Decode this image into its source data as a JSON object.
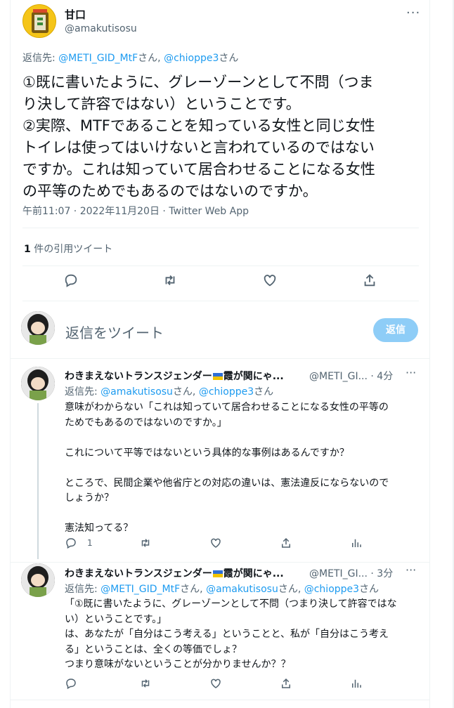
{
  "main_tweet": {
    "author_name": "甘口",
    "author_handle": "@amakutisosu",
    "reply_prefix": "返信先: ",
    "reply_to": [
      "@METI_GID_MtF",
      "さん, ",
      "@chioppe3",
      "さん"
    ],
    "text": "①既に書いたように、グレーゾーンとして不問（つま\nり決して許容ではない）ということです。\n②実際、MTFであることを知っている女性と同じ女性\nトイレは使ってはいけないと言われているのではない\nですか。これは知っていて居合わせることになる女性\nの平等のためでもあるのではないのですか。",
    "meta": "午前11:07 · 2022年11月20日 · Twitter Web App",
    "quote_count": "1",
    "quote_label": " 件の引用ツイート"
  },
  "composer": {
    "placeholder": "返信をツイート",
    "reply_button": "返信"
  },
  "replies": [
    {
      "name_pre": "わきまえないトランスジェンダー",
      "name_post": "霞が関にゃ...",
      "handle": "@METI_GI...",
      "time": " · 4分",
      "reply_prefix": "返信先: ",
      "reply_to": [
        "@amakutisosu",
        "さん, ",
        "@chioppe3",
        "さん"
      ],
      "text": "意味がわからない「これは知っていて居合わせることになる女性の平等の\nためでもあるのではないのですか。」\n\nこれについて平等ではないという具体的な事例はあるんですか？\n\nところで、民間企業や他省庁との対応の違いは、憲法違反にならないので\nしょうか？\n\n憲法知ってる？",
      "reply_count": "1"
    },
    {
      "name_pre": "わきまえないトランスジェンダー",
      "name_post": "霞が関にゃ...",
      "handle": "@METI_GI...",
      "time": " · 3分",
      "reply_prefix": "返信先: ",
      "reply_to": [
        "@METI_GID_MtF",
        "さん, ",
        "@amakutisosu",
        "さん, ",
        "@chioppe3",
        "さん"
      ],
      "text": "「①既に書いたように、グレーゾーンとして不問（つまり決して許容ではな\nい）ということです。」\nは、あなたが「自分はこう考える」ということと、私が「自分はこう考え\nる」ということは、全くの等価でしょ？\nつまり意味がないということが分かりませんか？？",
      "reply_count": ""
    }
  ],
  "colors": {
    "link": "#1d9bf0",
    "muted": "#536471",
    "button": "#8ecdf7"
  },
  "icons": [
    "reply-icon",
    "retweet-icon",
    "like-icon",
    "share-icon",
    "analytics-icon",
    "more-icon"
  ]
}
